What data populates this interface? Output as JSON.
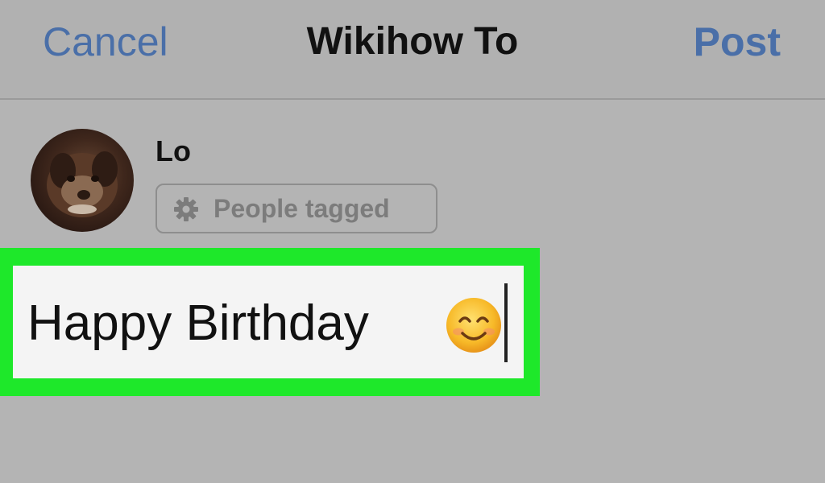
{
  "nav": {
    "cancel_label": "Cancel",
    "title": "Wikihow To",
    "post_label": "Post"
  },
  "user": {
    "name": "Lo"
  },
  "tag": {
    "label": "People tagged",
    "icon": "gear-icon"
  },
  "composer": {
    "text": "Happy Birthday",
    "emoji": "smiling-face-emoji"
  },
  "colors": {
    "accent": "#4a6fa8",
    "highlight": "#1ee82a",
    "background": "#b4b4b4"
  }
}
